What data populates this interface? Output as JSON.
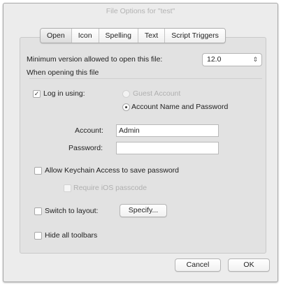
{
  "window": {
    "title": "File Options for \"test\""
  },
  "tabs": [
    "Open",
    "Icon",
    "Spelling",
    "Text",
    "Script Triggers"
  ],
  "min_version": {
    "label": "Minimum version allowed to open this file:",
    "value": "12.0"
  },
  "section_title": "When opening this file",
  "login": {
    "checkbox_label": "Log in using:",
    "checked": true,
    "guest_label": "Guest Account",
    "account_password_label": "Account Name and Password",
    "selected": "Account Name and Password",
    "account_label": "Account:",
    "account_value": "Admin",
    "password_label": "Password:",
    "password_value": ""
  },
  "keychain": {
    "label": "Allow Keychain Access to save password",
    "checked": false
  },
  "ios_passcode": {
    "label": "Require iOS passcode",
    "checked": false,
    "enabled": false
  },
  "layout": {
    "label": "Switch to layout:",
    "checked": false,
    "button": "Specify..."
  },
  "toolbars": {
    "label": "Hide all toolbars",
    "checked": false
  },
  "footer": {
    "cancel": "Cancel",
    "ok": "OK"
  },
  "icons": {
    "check": "✓",
    "updown": "⇕"
  }
}
